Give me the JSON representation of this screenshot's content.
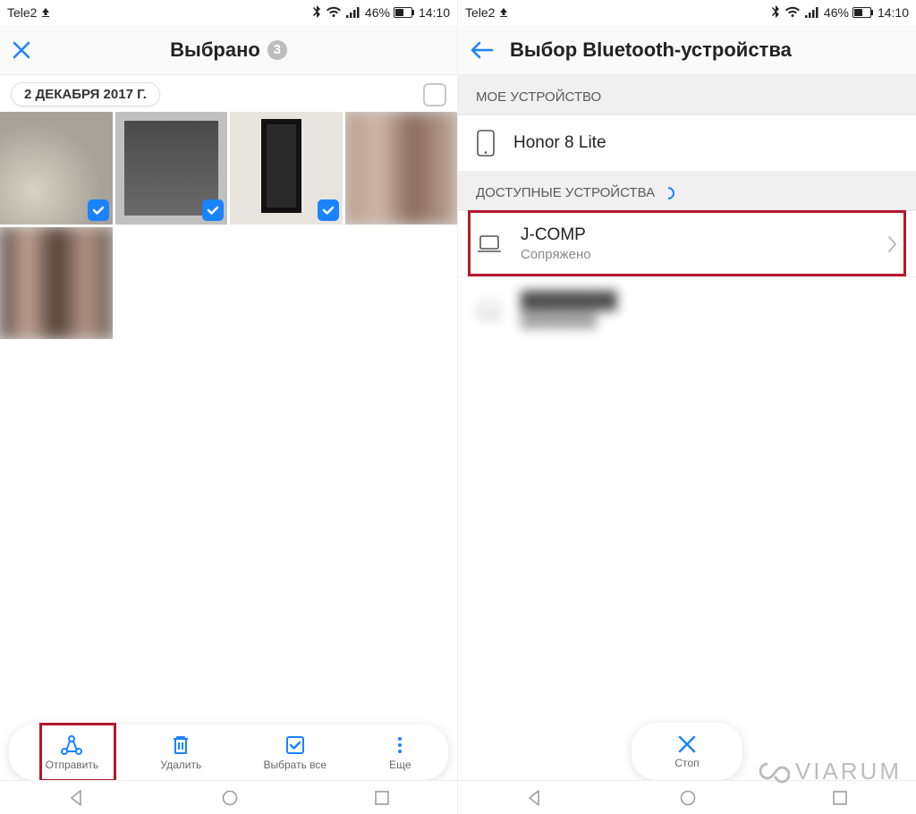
{
  "status": {
    "carrier": "Tele2",
    "battery_pct": "46%",
    "time": "14:10"
  },
  "left": {
    "title": "Выбрано",
    "selected_count": "3",
    "date": "2 ДЕКАБРЯ 2017 Г.",
    "actions": {
      "send": "Отправить",
      "delete": "Удалить",
      "select_all": "Выбрать все",
      "more": "Еще"
    }
  },
  "right": {
    "title": "Выбор Bluetooth-устройства",
    "sections": {
      "my_device_header": "МОЕ УСТРОЙСТВО",
      "available_header": "ДОСТУПНЫЕ УСТРОЙСТВА"
    },
    "my_device": {
      "name": "Honor 8 Lite"
    },
    "devices": [
      {
        "name": "J-COMP",
        "status": "Сопряжено"
      }
    ],
    "stop": "Стоп"
  },
  "watermark": "VIARUM"
}
